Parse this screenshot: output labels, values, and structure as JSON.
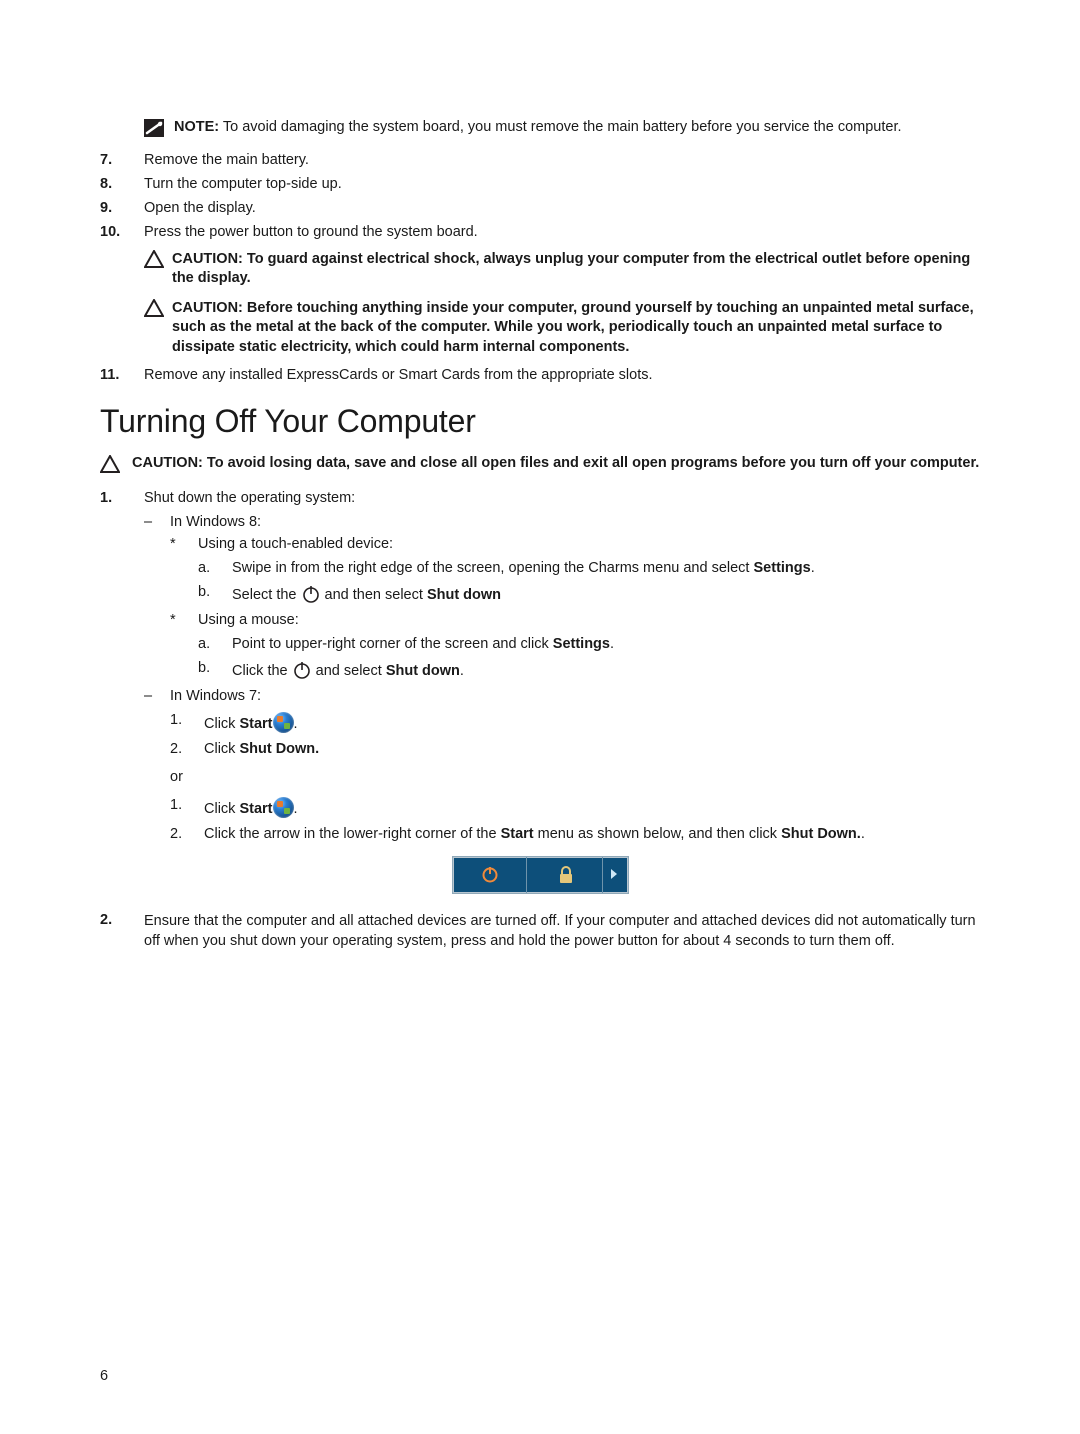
{
  "note1": {
    "label": "NOTE:",
    "text": " To avoid damaging the system board, you must remove the main battery before you service the computer."
  },
  "steps_a": [
    {
      "n": "7.",
      "t": "Remove the main battery."
    },
    {
      "n": "8.",
      "t": "Turn the computer top-side up."
    },
    {
      "n": "9.",
      "t": "Open the display."
    },
    {
      "n": "10.",
      "t": "Press the power button to ground the system board."
    }
  ],
  "caution1": "CAUTION: To guard against electrical shock, always unplug your computer from the electrical outlet before opening the display.",
  "caution2": "CAUTION: Before touching anything inside your computer, ground yourself by touching an unpainted metal surface, such as the metal at the back of the computer. While you work, periodically touch an unpainted metal surface to dissipate static electricity, which could harm internal components.",
  "step11": {
    "n": "11.",
    "t": "Remove any installed ExpressCards or Smart Cards from the appropriate slots."
  },
  "h2": "Turning Off Your Computer",
  "caution3": "CAUTION: To avoid losing data, save and close all open files and exit all open programs before you turn off your computer.",
  "step_b1": {
    "n": "1.",
    "t": "Shut down the operating system:"
  },
  "dash_win8": "In Windows 8:",
  "star_touch": "Using a touch-enabled device:",
  "w8_a_pre": "Swipe in from the right edge of the screen, opening the Charms menu and select ",
  "w8_a_bold": "Settings",
  "w8_b_pre": "Select the ",
  "w8_b_mid": " and then select ",
  "w8_b_bold": "Shut down",
  "star_mouse": "Using a mouse:",
  "w8m_a_pre": "Point to upper-right corner of the screen and click ",
  "w8m_a_bold": "Settings",
  "w8m_b_pre": "Click the ",
  "w8m_b_mid": " and select ",
  "w8m_b_bold": "Shut down",
  "dash_win7": "In Windows 7:",
  "w7_1_pre": "Click ",
  "w7_1_bold": "Start",
  "w7_2_pre": "Click ",
  "w7_2_bold": "Shut Down.",
  "or_text": "or",
  "w7b_1_pre": "Click ",
  "w7b_1_bold": "Start",
  "w7b_2_pre": "Click the arrow in the lower-right corner of the ",
  "w7b_2_bold1": "Start",
  "w7b_2_mid": " menu as shown below, and then click ",
  "w7b_2_bold2": "Shut Down.",
  "step_b2": {
    "n": "2.",
    "t": "Ensure that the computer and all attached devices are turned off. If your computer and attached devices did not automatically turn off when you shut down your operating system, press and hold the power button for about 4 seconds to turn them off."
  },
  "labels": {
    "a": "a.",
    "b": "b.",
    "one": "1.",
    "two": "2.",
    "dash": "–",
    "star": "*",
    "dot": "."
  },
  "page_number": "6"
}
